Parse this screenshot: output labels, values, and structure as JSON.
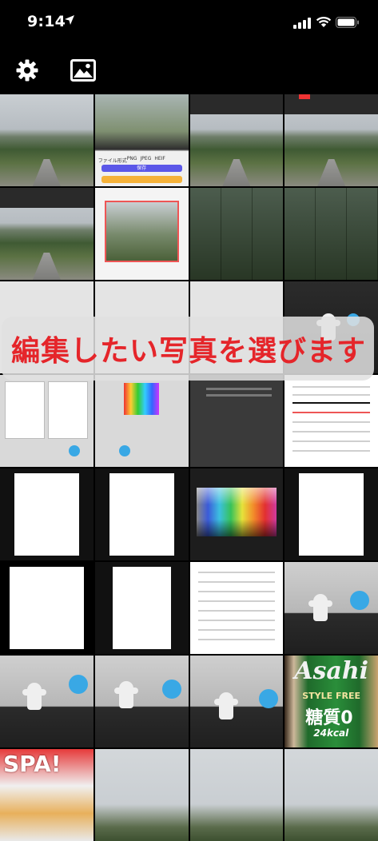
{
  "status": {
    "time": "9:14"
  },
  "toolbar": {
    "settings_icon": "gear-icon",
    "photo_icon": "photo-icon"
  },
  "banner": {
    "text": "編集したい写真を選びます",
    "color": "#e5252a"
  },
  "tile_texts": {
    "file_type_label": "ファイル形式",
    "formats": [
      "PNG",
      "JPEG",
      "HEIF"
    ],
    "save_label": "保存",
    "beer_brand": "Asahi",
    "beer_sub": "STYLE FREE",
    "beer_text": "糖質0",
    "beer_kcal": "24kcal",
    "magazine": "SPA!"
  },
  "grid": {
    "rows": [
      [
        "landscape",
        "app-export",
        "landscape-dark",
        "landscape-dark"
      ],
      [
        "landscape-dark",
        "crop",
        "mosaic",
        "mosaic"
      ],
      [
        "gray",
        "gray",
        "gray",
        "figure-dark"
      ],
      [
        "doc-small",
        "palette-small",
        "dark-tile",
        "doc"
      ],
      [
        "doc-black",
        "doc-black",
        "palette",
        "doc-black"
      ],
      [
        "doc",
        "doc-black",
        "doc",
        "figurine"
      ],
      [
        "figurine",
        "figurine",
        "figurine",
        "beer"
      ],
      [
        "magazine",
        "sky",
        "sky",
        "sky"
      ]
    ]
  }
}
